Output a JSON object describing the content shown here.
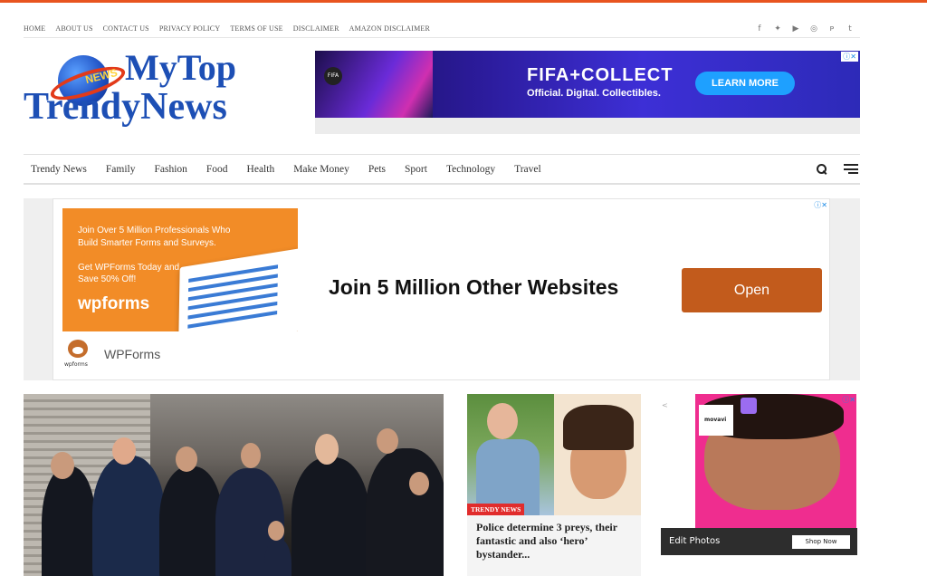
{
  "top_menu": [
    "HOME",
    "ABOUT US",
    "CONTACT US",
    "PRIVACY POLICY",
    "TERMS OF USE",
    "DISCLAIMER",
    "AMAZON DISCLAIMER"
  ],
  "social_icons": [
    {
      "name": "facebook-icon",
      "glyph": "f"
    },
    {
      "name": "twitter-icon",
      "glyph": "✦"
    },
    {
      "name": "youtube-icon",
      "glyph": "▶"
    },
    {
      "name": "instagram-icon",
      "glyph": "◎"
    },
    {
      "name": "pinterest-icon",
      "glyph": "ᴘ"
    },
    {
      "name": "tumblr-icon",
      "glyph": "t"
    }
  ],
  "logo": {
    "line1": "MyTop",
    "line2": "TrendyNews",
    "badge": "NEWS"
  },
  "ad_top": {
    "brand": "FIFA+COLLECT",
    "tagline": "Official. Digital. Collectibles.",
    "cta": "LEARN MORE"
  },
  "main_nav": [
    "Trendy News",
    "Family",
    "Fashion",
    "Food",
    "Health",
    "Make Money",
    "Pets",
    "Sport",
    "Technology",
    "Travel"
  ],
  "ad_big": {
    "promo_line1": "Join Over 5 Million Professionals Who Build Smarter Forms and Surveys.",
    "promo_line2": "Get WPForms Today and Save 50% Off!",
    "promo_brand": "wpforms",
    "logo_text": "wpforms",
    "headline": "Join 5 Million Other Websites",
    "button": "Open",
    "advertiser": "WPForms"
  },
  "featured_card": {
    "tag": "TRENDY NEWS",
    "title": "Police determine 3 preys, their fantastic and also ‘hero’ bystander..."
  },
  "ad_side": {
    "brand": "movavi",
    "caption": "Edit Photos",
    "button": "Shop Now"
  },
  "colors": {
    "accent": "#e8541f",
    "logo_blue": "#1d4fb5",
    "tag_red": "#e12c2c",
    "open_button": "#c25b1c"
  }
}
